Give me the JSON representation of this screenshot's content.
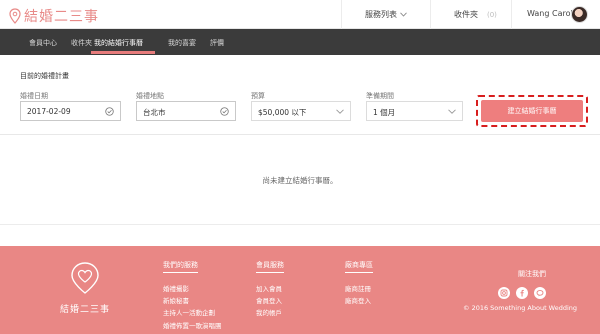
{
  "header": {
    "brand": "結婚二三事",
    "services_label": "服務列表",
    "favorites_label": "收件夾",
    "favorites_count": "(0)",
    "user_name": "Wang  Carol"
  },
  "nav": {
    "items": [
      {
        "label": "會員中心"
      },
      {
        "label": "收件夾"
      },
      {
        "label": "我的結婚行事曆"
      },
      {
        "label": "我的喜宴"
      },
      {
        "label": "評價"
      }
    ]
  },
  "plan": {
    "title": "目前的婚禮計畫",
    "date_label": "婚禮日期",
    "date_value": "2017-02-09",
    "location_label": "婚禮地點",
    "location_value": "台北市",
    "budget_label": "預算",
    "budget_value": "$50,000 以下",
    "prep_label": "準備期間",
    "prep_value": "1 個月",
    "create_button": "建立結婚行事曆"
  },
  "empty_message": "尚未建立結婚行事曆。",
  "footer": {
    "brand": "結婚二三事",
    "col1_title": "我們的服務",
    "col1_links": [
      "婚禮攝影",
      "新娘秘書",
      "主持人一活動企劃",
      "婚禮佈置一歌演唱團"
    ],
    "col2_title": "會員服務",
    "col2_links": [
      "加入會員",
      "會員登入",
      "我的帳戶"
    ],
    "col3_title": "廠商專區",
    "col3_links": [
      "廠商註冊",
      "廠商登入"
    ],
    "follow_label": "關注我們",
    "copyright": "© 2016 Something About Wedding"
  },
  "colors": {
    "brand": "#e88a88",
    "nav_bg": "#3b3b3b",
    "accent": "#ee7e7e",
    "footer_bg": "#e98785"
  }
}
